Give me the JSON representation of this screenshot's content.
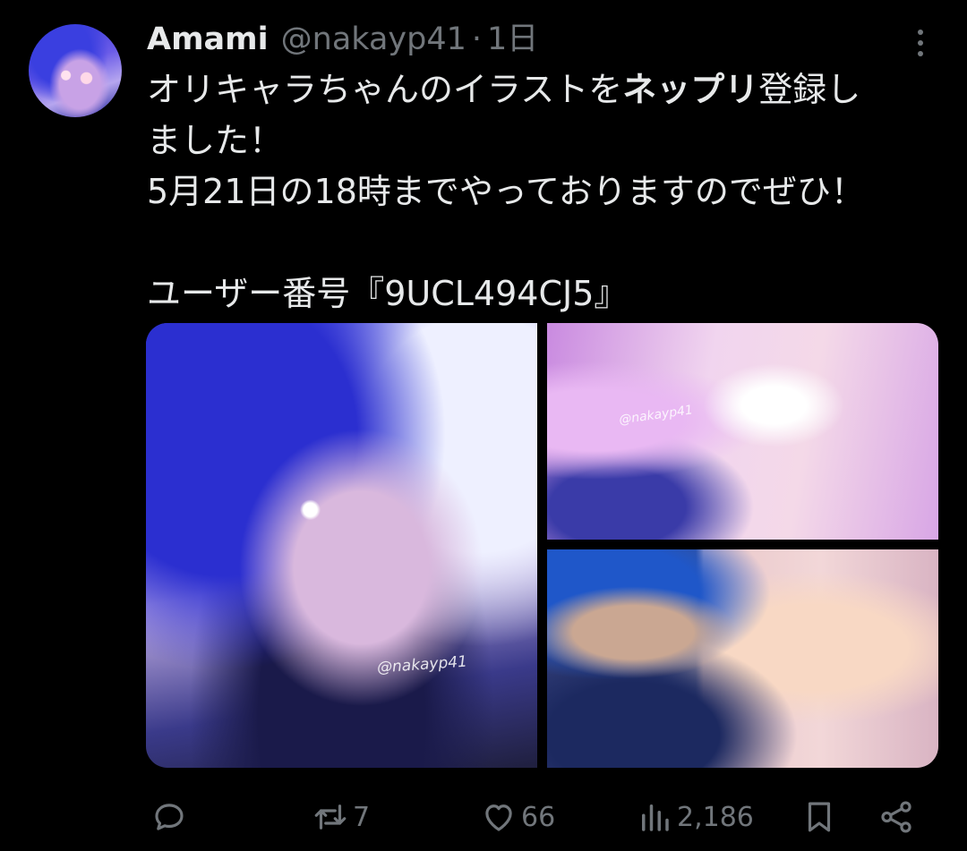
{
  "author": {
    "display_name": "Amami",
    "handle": "@nakayp41",
    "separator": "·",
    "timestamp": "1日"
  },
  "tweet": {
    "line1_pre": "オリキャラちゃんのイラストを",
    "line1_bold": "ネップリ",
    "line1_post": "登録し",
    "line2": "ました！",
    "line3": "5月21日の18時までやっておりますのでぜひ！",
    "line5": "ユーザー番号『9UCL494CJ5』"
  },
  "media": {
    "watermark_1": "@nakayp41",
    "watermark_2": "@nakayp41"
  },
  "actions": {
    "reply_count": "",
    "retweet_count": "7",
    "like_count": "66",
    "views_count": "2,186"
  },
  "colors": {
    "background": "#000000",
    "text": "#e7e9ea",
    "muted": "#71767b"
  },
  "icons": [
    "more-icon",
    "reply-icon",
    "retweet-icon",
    "like-icon",
    "views-icon",
    "bookmark-icon",
    "share-icon"
  ]
}
